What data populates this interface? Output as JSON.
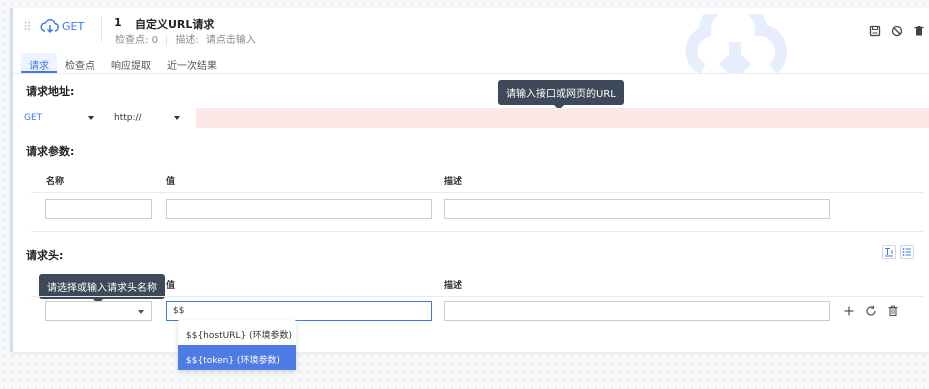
{
  "step": {
    "drag_glyph": "⠿",
    "method": "GET",
    "number": "1",
    "title": "自定义URL请求",
    "checkpoints_label": "检查点:",
    "checkpoints_value": "0",
    "description_label": "描述:",
    "description_placeholder": "请点击输入",
    "icons": [
      "save-icon",
      "disable-icon",
      "delete-icon"
    ]
  },
  "tabs": [
    {
      "label": "请求",
      "active": true
    },
    {
      "label": "检查点",
      "active": false
    },
    {
      "label": "响应提取",
      "active": false
    },
    {
      "label": "近一次结果",
      "active": false
    }
  ],
  "request_url": {
    "section_label": "请求地址:",
    "method_value": "GET",
    "protocol_value": "http://",
    "tooltip": "请输入接口或网页的URL"
  },
  "params": {
    "section_label": "请求参数:",
    "columns": [
      "名称",
      "值",
      "描述"
    ]
  },
  "headers": {
    "section_label": "请求头:",
    "columns": [
      "值",
      "描述"
    ],
    "tooltip": "请选择或输入请求头名称",
    "value_input": "$$",
    "dropdown": [
      {
        "label": "$${hostURL} (环境参数)",
        "active": false
      },
      {
        "label": "$${token} (环境参数)",
        "active": true
      }
    ],
    "row_icons": [
      "add-icon",
      "refresh-icon",
      "delete-icon"
    ],
    "toolbar_icons": [
      "text-mode-icon",
      "list-mode-icon"
    ]
  },
  "colors": {
    "accent": "#3c7af0",
    "url_error_bg": "#fde8e8",
    "tooltip_bg": "#3e4a59",
    "dropdown_active": "#4f7be6"
  }
}
